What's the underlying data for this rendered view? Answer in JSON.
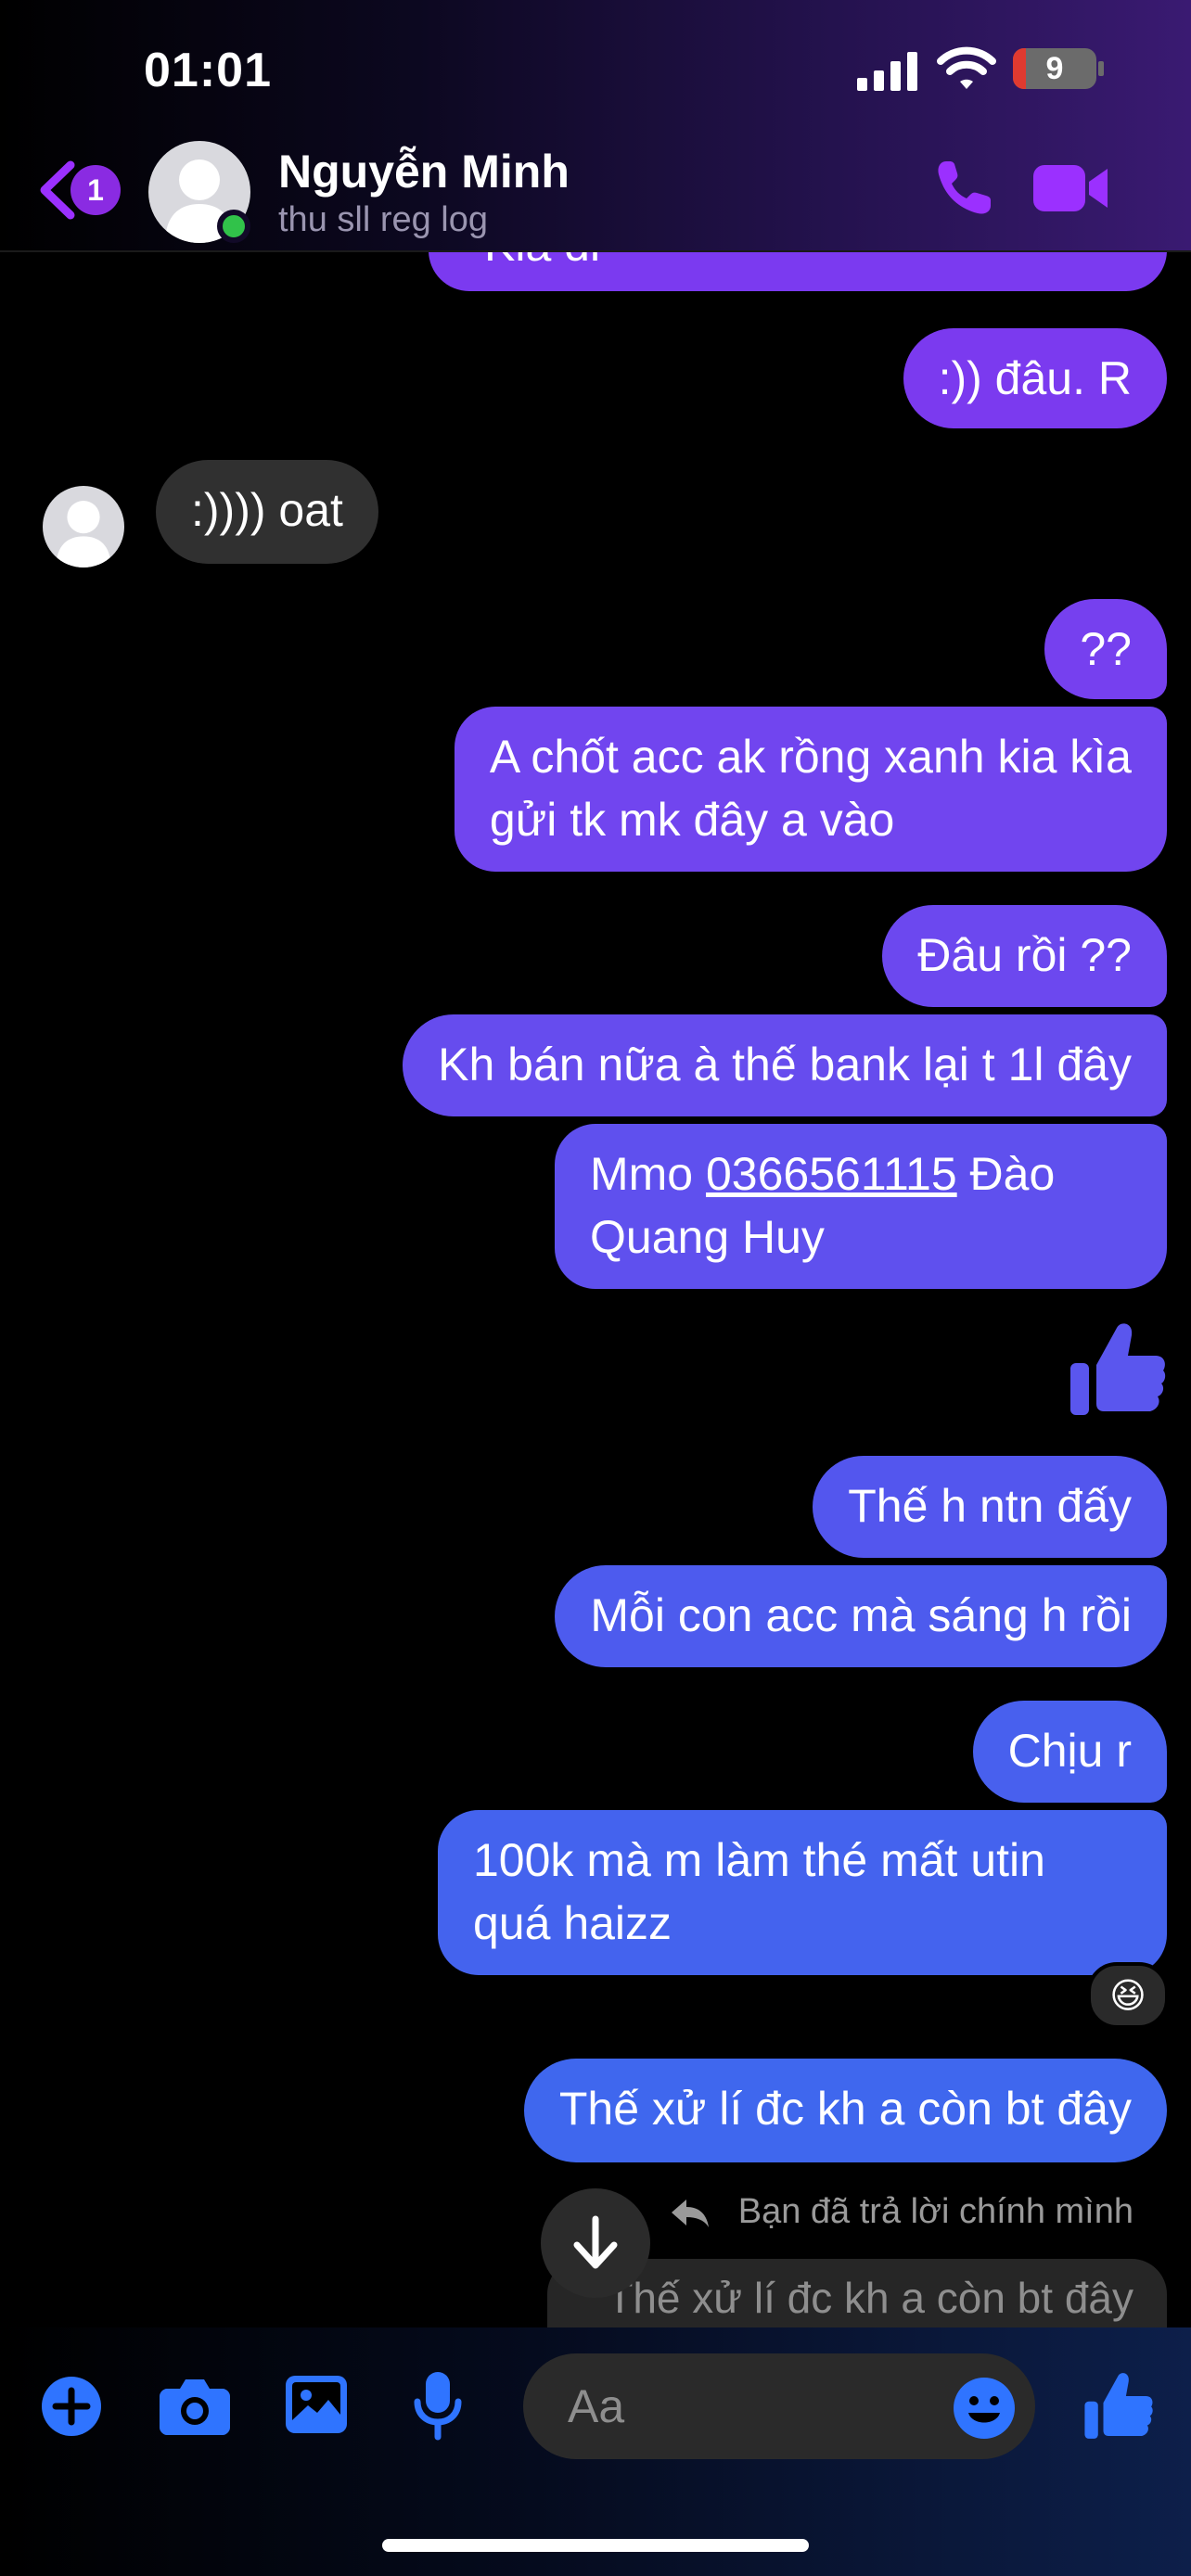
{
  "status_bar": {
    "time": "01:01",
    "battery": "9"
  },
  "header": {
    "back_badge": "1",
    "contact_name": "Nguyễn Minh",
    "contact_status": "thu sll reg log"
  },
  "messages": [
    {
      "from": "me",
      "text": "Kia đi"
    },
    {
      "from": "me",
      "text": ":)) đâu. R"
    },
    {
      "from": "them",
      "text": ":)))) oat"
    },
    {
      "from": "me",
      "text": "??"
    },
    {
      "from": "me",
      "lines": [
        "A chốt acc ak rồng xanh kia kìa",
        "gửi tk mk đây a vào"
      ]
    },
    {
      "from": "me",
      "text": "Đâu rồi ??"
    },
    {
      "from": "me",
      "text": "Kh bán nữa à thế bank lại t 1l đây"
    },
    {
      "from": "me",
      "line1_prefix": "Mmo ",
      "link": "0366561115",
      "line1_suffix": " Đào",
      "line2": "Quang Huy"
    },
    {
      "from": "me",
      "type": "like-sticker"
    },
    {
      "from": "me",
      "text": "Thế h ntn đấy"
    },
    {
      "from": "me",
      "text": "Mỗi con acc mà sáng h rồi"
    },
    {
      "from": "me",
      "text": "Chịu r"
    },
    {
      "from": "me",
      "lines": [
        "100k mà m làm thé mất utin",
        "quá haizz"
      ],
      "reaction": "😆"
    },
    {
      "from": "me",
      "text": "Thế xử lí đc kh a còn bt đây"
    }
  ],
  "reply": {
    "label": "Bạn đã trả lời chính mình",
    "quoted": "Thế xử lí đc kh a còn bt đây"
  },
  "composer": {
    "placeholder": "Aa"
  },
  "colors": {
    "accent": "#8a2be2",
    "bubble_top": "#7a3cf0",
    "bubble_bottom": "#3f66ee",
    "incoming": "#303030",
    "online": "#31c24a"
  }
}
